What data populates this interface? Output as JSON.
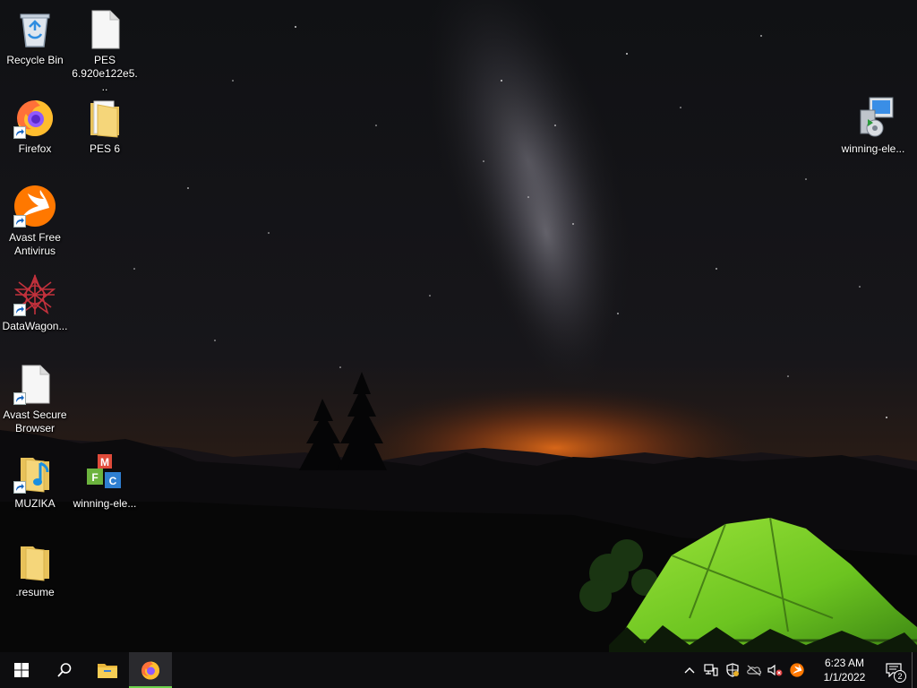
{
  "desktop": {
    "icons": [
      {
        "label": "Recycle Bin"
      },
      {
        "label": "PES 6.920e122e5..."
      },
      {
        "label": "Firefox"
      },
      {
        "label": "PES 6"
      },
      {
        "label": "Avast Free Antivirus"
      },
      {
        "label": "DataWagon..."
      },
      {
        "label": "Avast Secure Browser"
      },
      {
        "label": "MUZIKA"
      },
      {
        "label": "winning-ele..."
      },
      {
        "label": ".resume"
      },
      {
        "label": "winning-ele..."
      }
    ]
  },
  "taskbar": {
    "clock": {
      "time": "6:23 AM",
      "date": "1/1/2022"
    },
    "notification_count": "2"
  },
  "colors": {
    "taskbar_bg": "#0d0d0f",
    "active_indicator": "#6bd14b",
    "tent_green": "#7fd42a",
    "horizon_glow": "#d4641a"
  }
}
